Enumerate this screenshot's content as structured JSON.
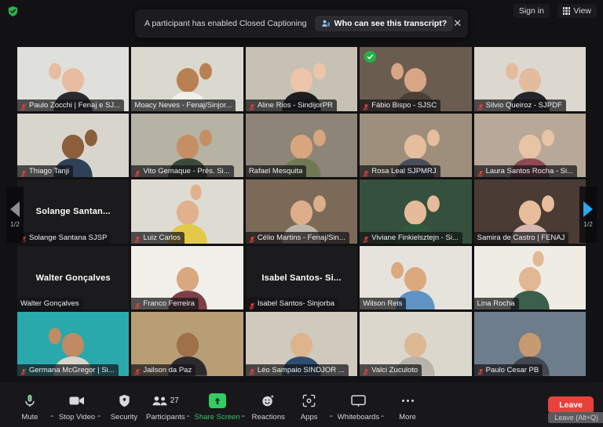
{
  "window": {
    "encryption_icon": "green-shield-check",
    "sign_in_label": "Sign in",
    "view_label": "View",
    "view_icon": "grid-icon"
  },
  "notification": {
    "message": "A participant has enabled Closed Captioning",
    "action_label": "Who can see this transcript?",
    "action_icon": "person-info-icon",
    "close_icon": "close-icon"
  },
  "gallery": {
    "page_indicator_left": "1/2",
    "page_indicator_right": "1/2",
    "prev_icon": "chevron-left-icon",
    "next_icon": "chevron-right-icon",
    "rows": [
      [
        {
          "name": "Paulo Zocchi | Fenaj e SJ...",
          "muted": true,
          "video": true,
          "active": false,
          "verified": false,
          "skin": "#e7bca0",
          "shirt": "#2a2a2e",
          "bg": "#dfe0dc",
          "hand": "left"
        },
        {
          "name": "Moacy Neves - Fenaj/Sinjor...",
          "muted": false,
          "video": true,
          "active": true,
          "verified": false,
          "skin": "#b98152",
          "shirt": "#f0efe9",
          "bg": "#dad9cf",
          "hand": "right"
        },
        {
          "name": "Aline Rios - SindijorPR",
          "muted": true,
          "video": true,
          "active": false,
          "verified": false,
          "skin": "#edc5ab",
          "shirt": "#1d1d21",
          "bg": "#c7c1b4",
          "hand": "right"
        },
        {
          "name": "Fábio Bispo - SJSC",
          "muted": true,
          "video": true,
          "active": false,
          "verified": true,
          "skin": "#d8a684",
          "shirt": "#4b4036",
          "bg": "#6b5c50",
          "hand": "left"
        },
        {
          "name": "Silvio Queiroz - SJPDF",
          "muted": true,
          "video": true,
          "active": false,
          "verified": false,
          "skin": "#e3bb9d",
          "shirt": "#24242a",
          "bg": "#ddd8cf",
          "hand": "left"
        }
      ],
      [
        {
          "name": "Thiago Tanji",
          "muted": true,
          "video": true,
          "active": false,
          "verified": false,
          "skin": "#8b5e3c",
          "shirt": "#2f4158",
          "bg": "#d8d5cd",
          "hand": "right"
        },
        {
          "name": "Vito Gemaque - Prés. Si...",
          "muted": true,
          "video": true,
          "active": false,
          "verified": false,
          "skin": "#c58f63",
          "shirt": "#3a4a3a",
          "bg": "#b6b2a4",
          "hand": "right"
        },
        {
          "name": "Rafael Mesquita",
          "muted": false,
          "video": true,
          "active": false,
          "verified": false,
          "skin": "#d9a57c",
          "shirt": "#6f7a55",
          "bg": "#8d8578",
          "hand": "right"
        },
        {
          "name": "Rosa Leal SJPMRJ",
          "muted": true,
          "video": true,
          "active": false,
          "verified": false,
          "skin": "#e6bd9d",
          "shirt": "#4a4e58",
          "bg": "#9d8f7c",
          "hand": "right"
        },
        {
          "name": "Laura Santos Rocha - Si...",
          "muted": true,
          "video": true,
          "active": false,
          "verified": false,
          "skin": "#e8c4a6",
          "shirt": "#8d4a52",
          "bg": "#b8a898",
          "hand": "right"
        }
      ],
      [
        {
          "name": "Solange Santana SJSP",
          "display_name": "Solange  Santan...",
          "muted": true,
          "video": false,
          "active": false,
          "verified": false
        },
        {
          "name": "Luiz Carlos",
          "muted": true,
          "video": true,
          "active": false,
          "verified": false,
          "skin": "#e0b18c",
          "shirt": "#e3c947",
          "bg": "#dedbd2",
          "hand": "up"
        },
        {
          "name": "Célio Martins - Fenaj/Sin...",
          "muted": true,
          "video": true,
          "active": false,
          "verified": false,
          "skin": "#dcae8a",
          "shirt": "#bdb4a6",
          "bg": "#7b6a58",
          "hand": "right"
        },
        {
          "name": "Viviane Finkielsztejn - Si...",
          "muted": true,
          "video": true,
          "active": false,
          "verified": false,
          "skin": "#e5bb9b",
          "shirt": "#2f5a3c",
          "bg": "#35503c",
          "hand": "right"
        },
        {
          "name": "Samira de Castro | FENAJ",
          "muted": false,
          "video": true,
          "active": false,
          "verified": false,
          "skin": "#e7bd9b",
          "shirt": "#d8b6b0",
          "bg": "#4b3b35",
          "hand": "right"
        }
      ],
      [
        {
          "name": "Walter Gonçalves",
          "display_name": "Walter Gonçalves",
          "muted": false,
          "video": false,
          "active": false,
          "verified": false
        },
        {
          "name": "Franco Ferreira",
          "muted": true,
          "video": true,
          "active": false,
          "verified": false,
          "skin": "#d9a87f",
          "shirt": "#7e4048",
          "bg": "#f1efe9",
          "hand": "none"
        },
        {
          "name": "Isabel Santos- Sinjorba",
          "display_name": "Isabel  Santos-  Si...",
          "muted": true,
          "video": false,
          "active": false,
          "verified": false
        },
        {
          "name": "Wilson Reis",
          "muted": false,
          "video": true,
          "active": false,
          "verified": false,
          "skin": "#dca87e",
          "shirt": "#5e93c4",
          "bg": "#e6e3dc",
          "hand": "left"
        },
        {
          "name": "Lina Rocha",
          "muted": false,
          "video": true,
          "active": false,
          "verified": false,
          "skin": "#e2b793",
          "shirt": "#3c5e4c",
          "bg": "#efece4",
          "hand": "up"
        }
      ],
      [
        {
          "name": "Germana McGregor | Si...",
          "muted": true,
          "video": true,
          "active": false,
          "verified": false,
          "skin": "#c08b63",
          "shirt": "#d9d5cb",
          "bg": "#2aa9ad",
          "hand": "left"
        },
        {
          "name": "Jailson da Paz",
          "muted": true,
          "video": true,
          "active": false,
          "verified": false,
          "skin": "#9f7049",
          "shirt": "#2b2b2f",
          "bg": "#b89e74",
          "hand": "none"
        },
        {
          "name": "Léo Sampaio SINDJOR ...",
          "muted": true,
          "video": true,
          "active": false,
          "verified": false,
          "skin": "#ddb48c",
          "shirt": "#2e4d72",
          "bg": "#cfcabd",
          "hand": "none"
        },
        {
          "name": "Valci Zuculoto",
          "muted": true,
          "video": true,
          "active": false,
          "verified": false,
          "skin": "#dcb993",
          "shirt": "#b8b4ab",
          "bg": "#dcd7cd",
          "hand": "none"
        },
        {
          "name": "Paulo Cesar PB",
          "muted": true,
          "video": true,
          "active": false,
          "verified": false,
          "skin": "#c89a72",
          "shirt": "#41464f",
          "bg": "#6d7d8c",
          "hand": "none"
        }
      ]
    ]
  },
  "toolbar": {
    "items": [
      {
        "label": "Mute",
        "icon": "microphone-icon",
        "caret": true,
        "green": false
      },
      {
        "label": "Stop Video",
        "icon": "video-camera-icon",
        "caret": true,
        "green": false
      },
      {
        "label": "Security",
        "icon": "shield-icon",
        "caret": false,
        "green": false
      },
      {
        "label": "Participants",
        "icon": "people-icon",
        "caret": true,
        "green": false,
        "count": "27"
      },
      {
        "label": "Share Screen",
        "icon": "share-screen-icon",
        "caret": true,
        "green": true
      },
      {
        "label": "Reactions",
        "icon": "smiley-icon",
        "caret": false,
        "green": false
      },
      {
        "label": "Apps",
        "icon": "apps-icon",
        "caret": true,
        "green": false
      },
      {
        "label": "Whiteboards",
        "icon": "whiteboard-icon",
        "caret": true,
        "green": false
      },
      {
        "label": "More",
        "icon": "ellipsis-icon",
        "caret": false,
        "green": false
      }
    ],
    "leave_label": "Leave",
    "leave_alt_label": "Leave (Alt+Q)"
  }
}
